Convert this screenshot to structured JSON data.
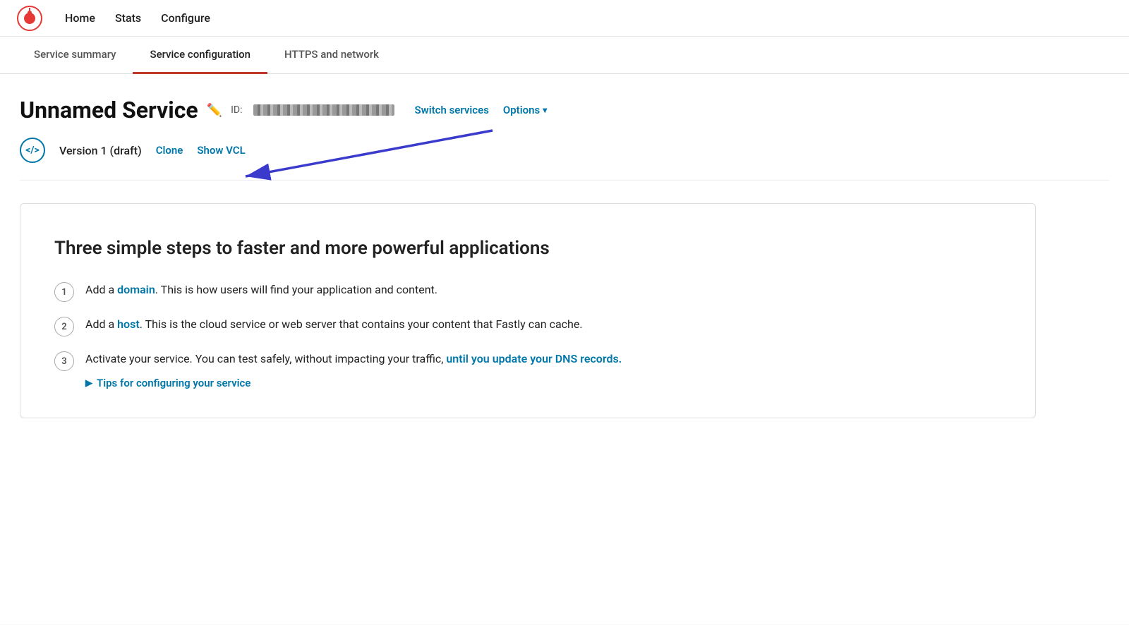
{
  "nav": {
    "links": [
      {
        "label": "Home",
        "id": "home"
      },
      {
        "label": "Stats",
        "id": "stats"
      },
      {
        "label": "Configure",
        "id": "configure"
      }
    ]
  },
  "tabs": [
    {
      "label": "Service summary",
      "id": "service-summary",
      "active": false
    },
    {
      "label": "Service configuration",
      "id": "service-configuration",
      "active": true
    },
    {
      "label": "HTTPS and network",
      "id": "https-network",
      "active": false
    }
  ],
  "service": {
    "name": "Unnamed Service",
    "id_label": "ID:",
    "id_value": "••••••••••••••••••••••••••",
    "switch_services_label": "Switch services",
    "options_label": "Options"
  },
  "version": {
    "text": "Version 1 (draft)",
    "clone_label": "Clone",
    "show_vcl_label": "Show VCL"
  },
  "steps_card": {
    "title": "Three simple steps to faster and more powerful applications",
    "steps": [
      {
        "number": "1",
        "before": "Add a ",
        "link_text": "domain",
        "after": ". This is how users will find your application and content."
      },
      {
        "number": "2",
        "before": "Add a ",
        "link_text": "host",
        "after": ". This is the cloud service or web server that contains your content that Fastly can cache."
      },
      {
        "number": "3",
        "before": "Activate your service. You can test safely, without impacting your traffic, ",
        "link_text": "until you update your DNS records.",
        "after": ""
      }
    ],
    "tips_label": "Tips for configuring your service"
  }
}
